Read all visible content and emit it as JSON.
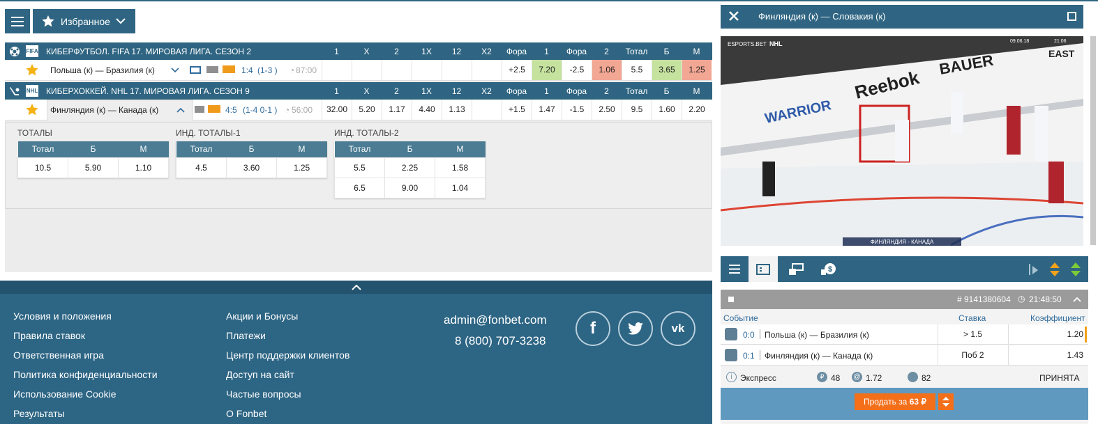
{
  "toolbar": {
    "favorites_label": "Избранное"
  },
  "events": [
    {
      "league": "КИБЕРФУТБОЛ. FIFA 17. МИРОВАЯ ЛИГА. СЕЗОН 2",
      "league_icon": "FIFA",
      "columns": [
        "1",
        "X",
        "2",
        "1X",
        "12",
        "X2",
        "Фора",
        "1",
        "Фора",
        "2",
        "Тотал",
        "Б",
        "М"
      ],
      "match": "Польша (к) — Бразилия (к)",
      "score": "1:4",
      "period_score": "(1-3 )",
      "time": "87:00",
      "odds": [
        "",
        "",
        "",
        "",
        "",
        "",
        "+2.5",
        "7.20",
        "-2.5",
        "1.06",
        "5.5",
        "3.65",
        "1.25"
      ]
    },
    {
      "league": "КИБЕРХОККЕЙ. NHL 17. МИРОВАЯ ЛИГА. СЕЗОН 9",
      "league_icon": "NHL",
      "columns": [
        "1",
        "X",
        "2",
        "1X",
        "12",
        "X2",
        "Фора",
        "1",
        "Фора",
        "2",
        "Тотал",
        "Б",
        "М"
      ],
      "match": "Финляндия (к) — Канада (к)",
      "score": "4:5",
      "period_score": "(1-4 0-1 )",
      "time": "56:00",
      "odds": [
        "32.00",
        "5.20",
        "1.17",
        "4.40",
        "1.13",
        "",
        "+1.5",
        "1.47",
        "-1.5",
        "2.50",
        "9.5",
        "1.60",
        "2.20"
      ]
    }
  ],
  "totals": [
    {
      "title": "ТОТАЛЫ",
      "headers": [
        "Тотал",
        "Б",
        "М"
      ],
      "rows": [
        [
          "10.5",
          "5.90",
          "1.10"
        ]
      ]
    },
    {
      "title": "ИНД. ТОТАЛЫ-1",
      "headers": [
        "Тотал",
        "Б",
        "М"
      ],
      "rows": [
        [
          "4.5",
          "3.60",
          "1.25"
        ]
      ]
    },
    {
      "title": "ИНД. ТОТАЛЫ-2",
      "headers": [
        "Тотал",
        "Б",
        "М"
      ],
      "rows": [
        [
          "5.5",
          "2.25",
          "1.58"
        ],
        [
          "6.5",
          "9.00",
          "1.04"
        ]
      ]
    }
  ],
  "footer": {
    "col1": [
      "Условия и положения",
      "Правила ставок",
      "Ответственная игра",
      "Политика конфиденциальности",
      "Использование Cookie",
      "Результаты"
    ],
    "col2": [
      "Акции и Бонусы",
      "Платежи",
      "Центр поддержки клиентов",
      "Доступ на сайт",
      "Частые вопросы",
      "О Fonbet"
    ],
    "email": "admin@fonbet.com",
    "phone": "8 (800) 707-3238",
    "social": [
      "f",
      "t",
      "vk"
    ]
  },
  "video": {
    "title": "Финляндия (к) — Словакия (к)",
    "caption": "ФИНЛЯНДИЯ - КАНАДА",
    "date": "09.06.18",
    "clock": "21:06",
    "brand_text": [
      "Reebok",
      "BAUER",
      "WARRIOR"
    ],
    "overlay_logo": "ESPORTS.BET",
    "nhl": "NHL",
    "east": "EAST"
  },
  "coupon": {
    "id": "# 9141380604",
    "time": "21:48:50",
    "col_event": "Событие",
    "col_stake": "Ставка",
    "col_coef": "Коэффициент",
    "bets": [
      {
        "score": "0:0",
        "name": "Польша (к) — Бразилия (к)",
        "stake": "> 1.5",
        "coef": "1.20"
      },
      {
        "score": "0:1",
        "name": "Финляндия (к) — Канада (к)",
        "stake": "Поб 2",
        "coef": "1.43"
      }
    ],
    "type": "Экспресс",
    "amount": "48",
    "total_coef": "1.72",
    "bonus": "82",
    "status": "ПРИНЯТА",
    "sell_label": "Продать за",
    "sell_amount": "63 ₽"
  },
  "colors": {
    "primary": "#2f6582",
    "green": "#c5e29f",
    "red": "#f2a694",
    "orange": "#f36f1a"
  }
}
